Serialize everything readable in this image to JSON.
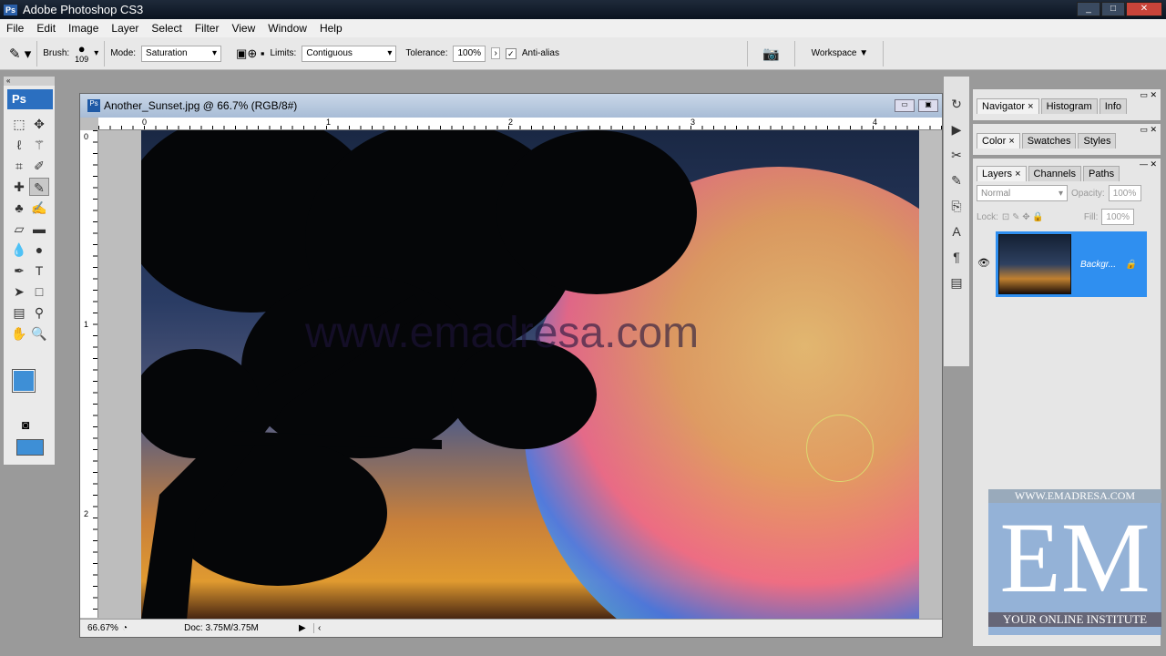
{
  "app": {
    "title": "Adobe Photoshop CS3",
    "logo": "Ps"
  },
  "menu": [
    "File",
    "Edit",
    "Image",
    "Layer",
    "Select",
    "Filter",
    "View",
    "Window",
    "Help"
  ],
  "options": {
    "brush_label": "Brush:",
    "brush_size": "109",
    "mode_label": "Mode:",
    "mode_value": "Saturation",
    "limits_label": "Limits:",
    "limits_value": "Contiguous",
    "tolerance_label": "Tolerance:",
    "tolerance_value": "100%",
    "antialias_label": "Anti-alias",
    "antialias_checked": true,
    "workspace_label": "Workspace ▼"
  },
  "document": {
    "title": "Another_Sunset.jpg @ 66.7% (RGB/8#)",
    "ruler_h": [
      "0",
      "1",
      "2",
      "3",
      "4"
    ],
    "ruler_v": [
      "0",
      "1",
      "2"
    ],
    "watermark": "www.emadresa.com",
    "zoom": "66.67%",
    "doc_size": "Doc: 3.75M/3.75M"
  },
  "toolbox": {
    "logo": "Ps"
  },
  "panels": {
    "group1": [
      "Navigator",
      "Histogram",
      "Info"
    ],
    "group2": [
      "Color",
      "Swatches",
      "Styles"
    ],
    "group3": [
      "Layers",
      "Channels",
      "Paths"
    ],
    "blend_mode": "Normal",
    "opacity_label": "Opacity:",
    "opacity": "100%",
    "lock_label": "Lock:",
    "fill_label": "Fill:",
    "fill": "100%",
    "layer_name": "Backgr..."
  },
  "branding": {
    "url": "WWW.EMADRESA.COM",
    "logo": "EM",
    "tagline": "YOUR ONLINE INSTITUTE"
  },
  "colors": {
    "foreground": "#3e8fd6",
    "layer_selected": "#2f8ff0"
  }
}
